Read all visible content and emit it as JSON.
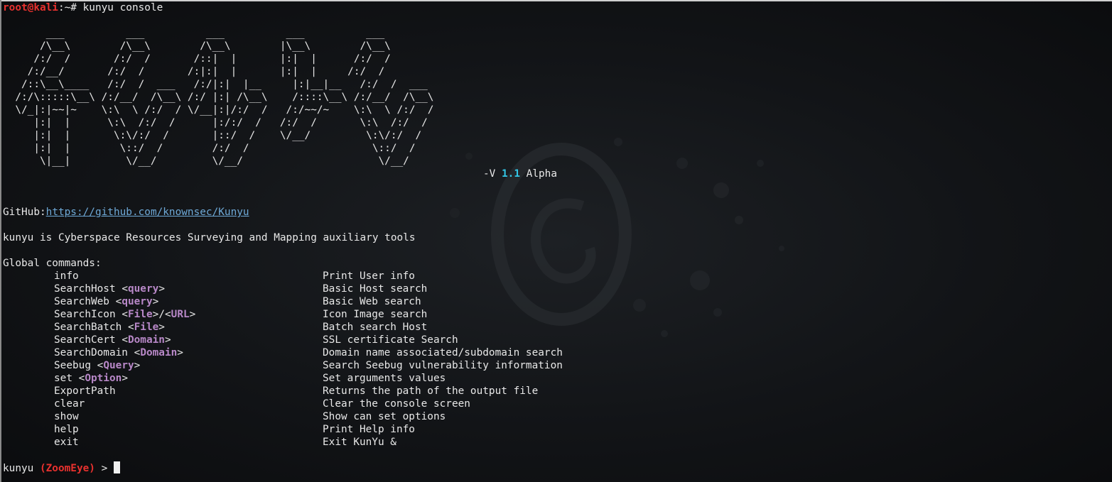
{
  "shell_prompt": {
    "user_host": "root@kali",
    "path_sep": ":~# ",
    "command": "kunyu console"
  },
  "banner": {
    "logo_lines": [
      "       ___          ___          ___          ___          ___     ",
      "      /\\__\\        /\\__\\        /\\__\\        |\\__\\        /\\__\\    ",
      "     /:/  /       /:/  /       /::|  |       |:|  |      /:/  /    ",
      "    /:/__/       /:/  /       /:|:|  |       |:|  |     /:/  /     ",
      "   /::\\__\\____   /:/  /  ___   /:/|:|  |__     |:|__|__   /:/  /  ___ ",
      "  /:/\\:::::\\__\\ /:/__/  /\\__\\ /:/ |:| /\\__\\    /::::\\__\\ /:/__/  /\\__\\",
      "  \\/_|:|~~|~    \\:\\  \\ /:/  / \\/__|:|/:/  /   /:/~~/~    \\:\\  \\ /:/  /",
      "     |:|  |      \\:\\  /:/  /      |:/:/  /   /:/  /       \\:\\  /:/  / ",
      "     |:|  |       \\:\\/:/  /       |::/  /    \\/__/         \\:\\/:/  /  ",
      "     |:|  |        \\::/  /        /:/  /                    \\::/  /   ",
      "      \\|__|         \\/__/         \\/__/                      \\/__/    "
    ],
    "version_prefix": "-V ",
    "version_number": "1.1",
    "version_suffix": " Alpha"
  },
  "github": {
    "label": "GitHub:",
    "url": "https://github.com/knownsec/Kunyu"
  },
  "tagline": "kunyu is Cyberspace Resources Surveying and Mapping auxiliary tools",
  "commands_header": "Global commands:",
  "commands": [
    {
      "name": "info",
      "args": [],
      "desc": "Print User info"
    },
    {
      "name": "SearchHost ",
      "args": [
        "query"
      ],
      "desc": "Basic Host search"
    },
    {
      "name": "SearchWeb ",
      "args": [
        "query"
      ],
      "desc": "Basic Web search"
    },
    {
      "name": "SearchIcon ",
      "args": [
        "File",
        "URL"
      ],
      "desc": "Icon Image search"
    },
    {
      "name": "SearchBatch ",
      "args": [
        "File"
      ],
      "desc": "Batch search Host"
    },
    {
      "name": "SearchCert ",
      "args": [
        "Domain"
      ],
      "desc": "SSL certificate Search"
    },
    {
      "name": "SearchDomain ",
      "args": [
        "Domain"
      ],
      "desc": "Domain name associated/subdomain search"
    },
    {
      "name": "Seebug ",
      "args": [
        "Query"
      ],
      "desc": "Search Seebug vulnerability information"
    },
    {
      "name": "set ",
      "args": [
        "Option"
      ],
      "desc": "Set arguments values"
    },
    {
      "name": "ExportPath",
      "args": [],
      "desc": "Returns the path of the output file"
    },
    {
      "name": "clear",
      "args": [],
      "desc": "Clear the console screen"
    },
    {
      "name": "show",
      "args": [],
      "desc": "Show can set options"
    },
    {
      "name": "help",
      "args": [],
      "desc": "Print Help info"
    },
    {
      "name": "exit",
      "args": [],
      "desc": "Exit KunYu &"
    }
  ],
  "console_prompt": {
    "app": "kunyu ",
    "mode": "(ZoomEye)",
    "arrow": " > "
  },
  "colors": {
    "prompt_red": "#e8312e",
    "arg_purple": "#b888c8",
    "version_cyan": "#33c7e6",
    "link_blue": "#6ea9d7"
  }
}
